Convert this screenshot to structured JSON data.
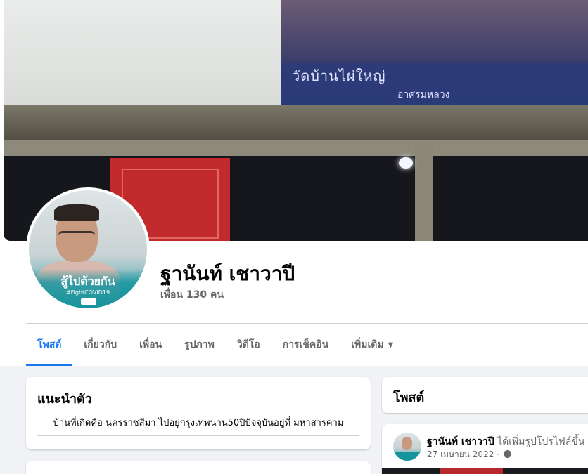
{
  "profile": {
    "name": "ฐานันท์ เชาวาปี",
    "friends_count": "เพื่อน 130 คน",
    "avatar_frame_title": "สู้ไปด้วยกัน",
    "avatar_frame_tag": "#FightCOVID19",
    "cover_banner_text": "วัดบ้านไผ่ใหญ่",
    "cover_banner_subtext": "อาศรมหลวง"
  },
  "tabs": [
    {
      "label": "โพสต์",
      "active": true
    },
    {
      "label": "เกี่ยวกับ",
      "active": false
    },
    {
      "label": "เพื่อน",
      "active": false
    },
    {
      "label": "รูปภาพ",
      "active": false
    },
    {
      "label": "วิดีโอ",
      "active": false
    },
    {
      "label": "การเช็คอิน",
      "active": false
    },
    {
      "label": "เพิ่มเติม",
      "active": false
    }
  ],
  "intro": {
    "title": "แนะนำตัว",
    "bio": "บ้านที่เกิดคือ นครราชสีมา ไปอยู่กรุงเทพนาน50ปีปัจจุบันอยู่ที่ มหาสารคาม"
  },
  "posts": {
    "title": "โพสต์",
    "items": [
      {
        "author": "ฐานันท์ เชาวาปี",
        "action": "ได้เพิ่มรูปโปรไฟล์ขึ้น",
        "date": "27 เมษายน 2022 ·"
      }
    ]
  },
  "colors": {
    "accent": "#1877f2",
    "secondary_text": "#65676b",
    "page_bg": "#f0f2f5"
  }
}
